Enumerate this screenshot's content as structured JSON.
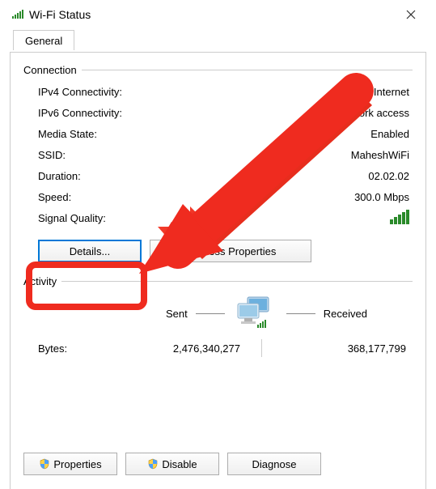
{
  "window": {
    "title": "Wi-Fi Status"
  },
  "tabs": {
    "general": "General"
  },
  "groups": {
    "connection": "Connection",
    "activity": "Activity"
  },
  "conn": {
    "ipv4_label": "IPv4 Connectivity:",
    "ipv4_value": "Internet",
    "ipv6_label": "IPv6 Connectivity:",
    "ipv6_value": "No network access",
    "media_label": "Media State:",
    "media_value": "Enabled",
    "ssid_label": "SSID:",
    "ssid_value": "MaheshWiFi",
    "duration_label": "Duration:",
    "duration_value": "02.02.02",
    "speed_label": "Speed:",
    "speed_value": "300.0 Mbps",
    "signal_label": "Signal Quality:"
  },
  "buttons": {
    "details": "Details...",
    "wireless_properties": "Wireless Properties",
    "properties": "Properties",
    "disable": "Disable",
    "diagnose": "Diagnose"
  },
  "activity": {
    "sent_label": "Sent",
    "received_label": "Received",
    "bytes_label": "Bytes:",
    "bytes_sent": "2,476,340,277",
    "bytes_received": "368,177,799"
  },
  "colors": {
    "highlight": "#ef2b1f",
    "signal_green": "#2a8a2a"
  }
}
